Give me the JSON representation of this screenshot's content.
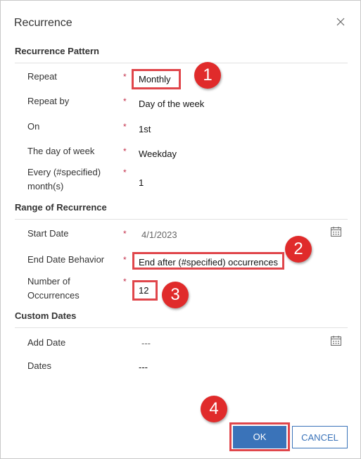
{
  "dialog": {
    "title": "Recurrence"
  },
  "sections": {
    "pattern": "Recurrence Pattern",
    "range": "Range of Recurrence",
    "custom": "Custom Dates"
  },
  "fields": {
    "repeat": {
      "label": "Repeat",
      "value": "Monthly"
    },
    "repeat_by": {
      "label": "Repeat by",
      "value": "Day of the week"
    },
    "on": {
      "label": "On",
      "value": "1st"
    },
    "day_of_week": {
      "label": "The day of week",
      "value": "Weekday"
    },
    "every": {
      "label_line1": "Every (#specified)",
      "label_line2": "month(s)",
      "value": "1"
    },
    "start_date": {
      "label": "Start Date",
      "value": "4/1/2023"
    },
    "end_behavior": {
      "label": "End Date Behavior",
      "value": "End after (#specified) occurrences"
    },
    "occurrences": {
      "label_line1": "Number of",
      "label_line2": "Occurrences",
      "value": "12"
    },
    "add_date": {
      "label": "Add Date",
      "value": "---"
    },
    "dates": {
      "label": "Dates",
      "value": "---"
    }
  },
  "required_mark": "*",
  "badges": [
    "1",
    "2",
    "3",
    "4"
  ],
  "buttons": {
    "ok": "OK",
    "cancel": "CANCEL"
  },
  "icons": {
    "close": "close-icon",
    "calendar": "calendar-icon"
  },
  "colors": {
    "accent": "#3a73b9",
    "highlight": "#e0464b",
    "badge": "#e02b2b",
    "required": "#c4314b"
  }
}
